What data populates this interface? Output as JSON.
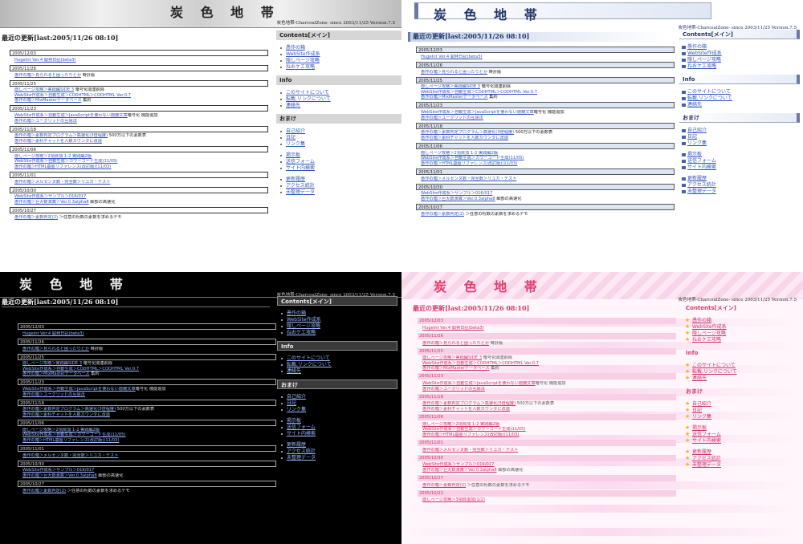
{
  "site": {
    "title": "炭 色 地 帯",
    "subtitle": "炭色地帯-CharcoalZone- since 2003/11/25  Version.7.5",
    "main_heading": "最近の更新[last:2005/11/26 08:10]"
  },
  "updates": [
    {
      "date": "2005/12/03",
      "items": [
        {
          "link": "HugeInt Ver.4 開発日記(beta3)",
          "rest": ""
        }
      ]
    },
    {
      "date": "2005/11/26",
      "items": [
        {
          "link": "愚作の箱＞見られると困ったりとか",
          "rest": " 時計版"
        }
      ]
    },
    {
      "date": "2005/11/25",
      "items": [
        {
          "link": "隠しページ攻略＞実践編SIDE 3",
          "rest": " 暗号化関連削除"
        },
        {
          "link": "WebSite作成系＞自動生成＞CODHTML＞CODHTML Ver.0.7",
          "rest": ""
        },
        {
          "link": "愚作の箱＞MixMasterデータベース",
          "rest": " 集約"
        }
      ]
    },
    {
      "date": "2005/11/23",
      "items": [
        {
          "link": "WebSite作成系＞自動生成＞JavaScriptを使わない隠蔽文章",
          "rest": "暗号化 機能追加"
        },
        {
          "link": "愚作の箱＞ユークリッドの互除法",
          "rest": ""
        }
      ]
    },
    {
      "date": "2005/11/18",
      "items": [
        {
          "link": "愚作の箱＞素数判定プログラム＞高速化(3倍程度)",
          "rest": " 500万以下の素数表"
        },
        {
          "link": "愚作の箱＞素科チャットを人数カウンタに改造",
          "rest": ""
        }
      ]
    },
    {
      "date": "2005/11/06",
      "items": [
        {
          "link": "隠しページ攻略＞2項目加 1-2 実践編2版",
          "rest": ""
        },
        {
          "link": "WebSite作成系＞自動生成＞カワーコード生成(11/05)",
          "rest": ""
        },
        {
          "link": "愚作の箱＞HTML基盤リファレンス(改訂版)(11/03)",
          "rest": ""
        }
      ]
    },
    {
      "date": "2005/11/01",
      "items": [
        {
          "link": "愚作の箱＞メルセンヌ数・完全数＞リユカ・テスト",
          "rest": ""
        }
      ]
    },
    {
      "date": "2005/10/30",
      "items": [
        {
          "link": "WebSite作成系＞サンプル＞016/017",
          "rest": ""
        },
        {
          "link": "愚作の箱＞巨大数演算＞Ver.0.3alpha8",
          "rest": " 細部の高速化"
        }
      ]
    },
    {
      "date": "2005/10/27",
      "items": [
        {
          "link": "愚作の箱＞素数判定(2)",
          "rest": " ＞任意の桁数の素数を求めるデモ"
        }
      ]
    }
  ],
  "sidebar": [
    {
      "heading": "Contents[メイン]",
      "groups": [
        [
          "愚作の箱",
          "WebSite作成系",
          "隠しページ攻略",
          "ねおケエ攻略"
        ]
      ]
    },
    {
      "heading": "Info",
      "groups": [
        [
          "このサイトについて",
          "転載,リンクについて",
          "連絡先"
        ]
      ]
    },
    {
      "heading": "おまけ",
      "groups": [
        [
          "自己紹介",
          "日記",
          "リンク集"
        ],
        [
          "掲示板",
          "送信フォーム",
          "サイト内検索"
        ],
        [
          "更新履歴",
          "アクセス統計",
          "未整理データ"
        ]
      ]
    }
  ],
  "pink_extra": {
    "date": "2005/10/22",
    "item": "隠しページ攻略＞3項目追加(1/2)"
  }
}
